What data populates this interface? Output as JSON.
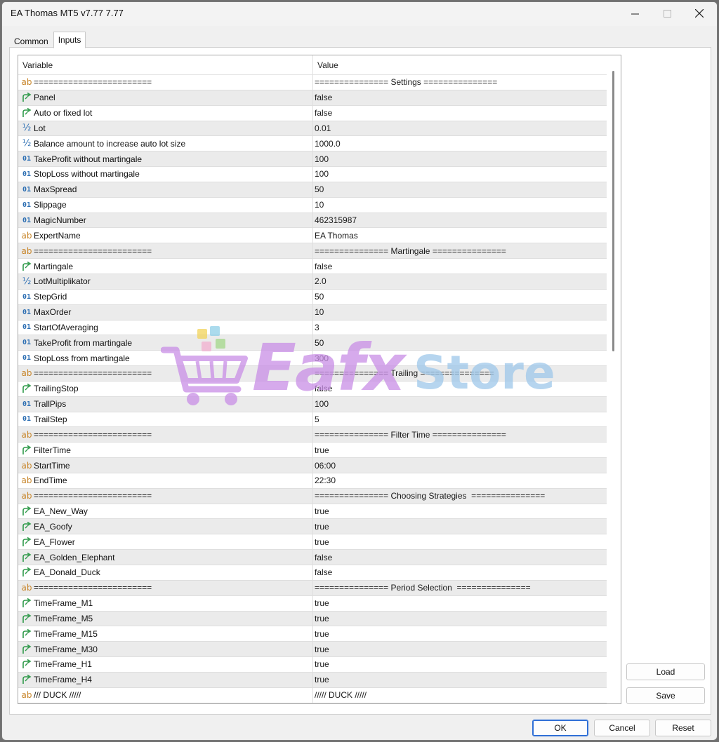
{
  "window": {
    "title": "EA Thomas MT5 v7.77 7.77"
  },
  "tabs": [
    {
      "label": "Common"
    },
    {
      "label": "Inputs"
    }
  ],
  "grid": {
    "header": {
      "variable": "Variable",
      "value": "Value"
    },
    "rows": [
      {
        "type": "str",
        "name": "========================",
        "value": "=============== Settings ==============="
      },
      {
        "type": "bool",
        "name": "Panel",
        "value": "false"
      },
      {
        "type": "bool",
        "name": "Auto or fixed lot",
        "value": "false"
      },
      {
        "type": "dbl",
        "name": "Lot",
        "value": "0.01"
      },
      {
        "type": "dbl",
        "name": "Balance amount to increase auto lot size",
        "value": "1000.0"
      },
      {
        "type": "int",
        "name": "TakeProfit without martingale",
        "value": "100"
      },
      {
        "type": "int",
        "name": "StopLoss without martingale",
        "value": "100"
      },
      {
        "type": "int",
        "name": "MaxSpread",
        "value": "50"
      },
      {
        "type": "int",
        "name": "Slippage",
        "value": "10"
      },
      {
        "type": "int",
        "name": "MagicNumber",
        "value": "462315987"
      },
      {
        "type": "str",
        "name": "ExpertName",
        "value": "EA Thomas"
      },
      {
        "type": "str",
        "name": "========================",
        "value": "=============== Martingale ==============="
      },
      {
        "type": "bool",
        "name": "Martingale",
        "value": "false"
      },
      {
        "type": "dbl",
        "name": "LotMultiplikator",
        "value": "2.0"
      },
      {
        "type": "int",
        "name": "StepGrid",
        "value": "50"
      },
      {
        "type": "int",
        "name": "MaxOrder",
        "value": "10"
      },
      {
        "type": "int",
        "name": "StartOfAveraging",
        "value": "3"
      },
      {
        "type": "int",
        "name": "TakeProfit from martingale",
        "value": "50"
      },
      {
        "type": "int",
        "name": "StopLoss from martingale",
        "value": "300"
      },
      {
        "type": "str",
        "name": "========================",
        "value": "=============== Trailing ==============="
      },
      {
        "type": "bool",
        "name": "TrailingStop",
        "value": "false"
      },
      {
        "type": "int",
        "name": "TrallPips",
        "value": "100"
      },
      {
        "type": "int",
        "name": "TrailStep",
        "value": "5"
      },
      {
        "type": "str",
        "name": "========================",
        "value": "=============== Filter Time ==============="
      },
      {
        "type": "bool",
        "name": "FilterTime",
        "value": "true"
      },
      {
        "type": "str",
        "name": "StartTime",
        "value": "06:00"
      },
      {
        "type": "str",
        "name": "EndTime",
        "value": "22:30"
      },
      {
        "type": "str",
        "name": "========================",
        "value": "=============== Choosing Strategies  ==============="
      },
      {
        "type": "bool",
        "name": "EA_New_Way",
        "value": "true"
      },
      {
        "type": "bool",
        "name": "EA_Goofy",
        "value": "true"
      },
      {
        "type": "bool",
        "name": "EA_Flower",
        "value": "true"
      },
      {
        "type": "bool",
        "name": "EA_Golden_Elephant",
        "value": "false"
      },
      {
        "type": "bool",
        "name": "EA_Donald_Duck",
        "value": "false"
      },
      {
        "type": "str",
        "name": "========================",
        "value": "=============== Period Selection  ==============="
      },
      {
        "type": "bool",
        "name": "TimeFrame_M1",
        "value": "true"
      },
      {
        "type": "bool",
        "name": "TimeFrame_M5",
        "value": "true"
      },
      {
        "type": "bool",
        "name": "TimeFrame_M15",
        "value": "true"
      },
      {
        "type": "bool",
        "name": "TimeFrame_M30",
        "value": "true"
      },
      {
        "type": "bool",
        "name": "TimeFrame_H1",
        "value": "true"
      },
      {
        "type": "bool",
        "name": "TimeFrame_H4",
        "value": "true"
      },
      {
        "type": "str",
        "name": "/// DUCK /////",
        "value": "///// DUCK /////"
      }
    ]
  },
  "icons": {
    "str": "ab",
    "int": "01",
    "dbl": "½",
    "bool": "bool-arrow-icon"
  },
  "buttons": {
    "load": "Load",
    "save": "Save",
    "ok": "OK",
    "cancel": "Cancel",
    "reset": "Reset"
  },
  "watermark": {
    "text_a": "Eafx",
    "text_b": "Store"
  }
}
